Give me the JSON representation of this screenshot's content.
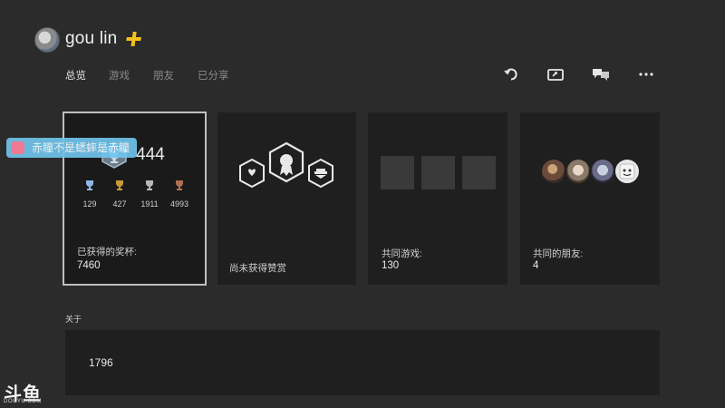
{
  "profile": {
    "username": "gou lin",
    "plus_icon": "playstation-plus-icon"
  },
  "tabs": [
    {
      "label": "总览",
      "active": true
    },
    {
      "label": "游戏",
      "active": false
    },
    {
      "label": "朋友",
      "active": false
    },
    {
      "label": "已分享",
      "active": false
    }
  ],
  "header_actions": [
    {
      "icon": "refresh-icon"
    },
    {
      "icon": "share-screen-icon"
    },
    {
      "icon": "messages-icon"
    },
    {
      "icon": "more-icon"
    }
  ],
  "trophies": {
    "level": "444",
    "counts": [
      {
        "type": "platinum",
        "value": "129",
        "color": "#8fb8e6"
      },
      {
        "type": "gold",
        "value": "427",
        "color": "#c89a3a"
      },
      {
        "type": "silver",
        "value": "1911",
        "color": "#b8b8b8"
      },
      {
        "type": "bronze",
        "value": "4993",
        "color": "#b07050"
      }
    ],
    "label": "已获得的奖杯:",
    "total": "7460"
  },
  "rewards": {
    "label": "尚未获得赞赏"
  },
  "shared_games": {
    "label": "共同游戏:",
    "value": "130"
  },
  "shared_friends": {
    "label": "共同的朋友:",
    "value": "4"
  },
  "about": {
    "label": "关于",
    "value": "1796"
  },
  "stream_overlay": {
    "badge_text": "赤瞳不是蟋蟀是赤瞳",
    "watermark": "斗鱼",
    "watermark_sub": "DOUYU.COM"
  }
}
